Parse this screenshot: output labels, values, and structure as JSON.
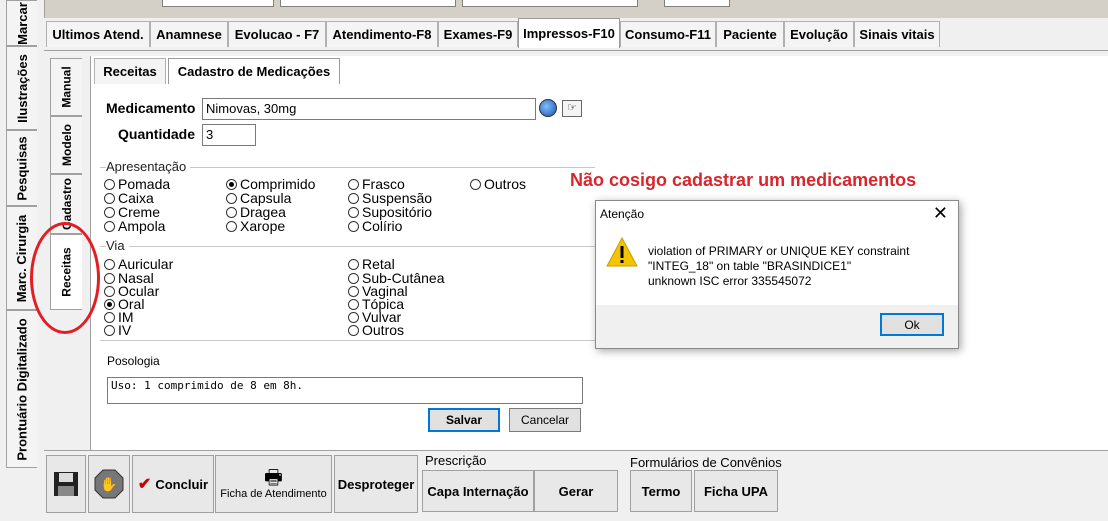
{
  "left_tabs": [
    "Marcar",
    "Ilustrações",
    "Pesquisas",
    "Marc. Cirurgia",
    "Prontuário Digitalizado"
  ],
  "top_tabs": [
    "Ultimos Atend.",
    "Anamnese",
    "Evolucao - F7",
    "Atendimento-F8",
    "Exames-F9",
    "Impressos-F10",
    "Consumo-F11",
    "Paciente",
    "Evolução",
    "Sinais vitais"
  ],
  "inner_tabs": [
    "Manual",
    "Modelo",
    "Cadastro",
    "Receitas"
  ],
  "sub_tabs": [
    "Receitas",
    "Cadastro de Medicações"
  ],
  "form": {
    "medicamento_label": "Medicamento",
    "medicamento_value": "Nimovas, 30mg",
    "quantidade_label": "Quantidade",
    "quantidade_value": "3",
    "apresentacao_title": "Apresentação",
    "apresentacao_options": [
      "Pomada",
      "Caixa",
      "Creme",
      "Ampola",
      "Comprimido",
      "Capsula",
      "Dragea",
      "Xarope",
      "Frasco",
      "Suspensão",
      "Supositório",
      "Colírio",
      "Outros"
    ],
    "apresentacao_selected": "Comprimido",
    "via_title": "Via",
    "via_options": [
      "Auricular",
      "Nasal",
      "Ocular",
      "Oral",
      "IM",
      "IV",
      "Retal",
      "Sub-Cutânea",
      "Vaginal",
      "Tópica",
      "Vulvar",
      "Outros"
    ],
    "via_selected": "Oral",
    "posologia_label": "Posologia",
    "posologia_value": "Uso: 1 comprimido de 8 em 8h.",
    "salvar": "Salvar",
    "cancelar": "Cancelar"
  },
  "annotation": "Não cosigo cadastrar um medicamentos",
  "dialog": {
    "title": "Atenção",
    "close": "✕",
    "line1": "violation of PRIMARY or UNIQUE KEY constraint",
    "line2": "\"INTEG_18\" on table \"BRASINDICE1\"",
    "line3": "unknown ISC error 335545072",
    "ok": "Ok"
  },
  "toolbar": {
    "concluir": "Concluir",
    "ficha_atendimento": "Ficha de Atendimento",
    "desproteger": "Desproteger",
    "prescricao_label": "Prescrição",
    "capa_internacao": "Capa Internação",
    "gerar": "Gerar",
    "formularios_label": "Formulários de Convênios",
    "termo": "Termo",
    "ficha_upa": "Ficha UPA"
  },
  "colors": {
    "annotation": "#d9262c",
    "circle": "#e31d23",
    "default_button_border": "#0078d7",
    "warning_icon": "#f5c400"
  }
}
